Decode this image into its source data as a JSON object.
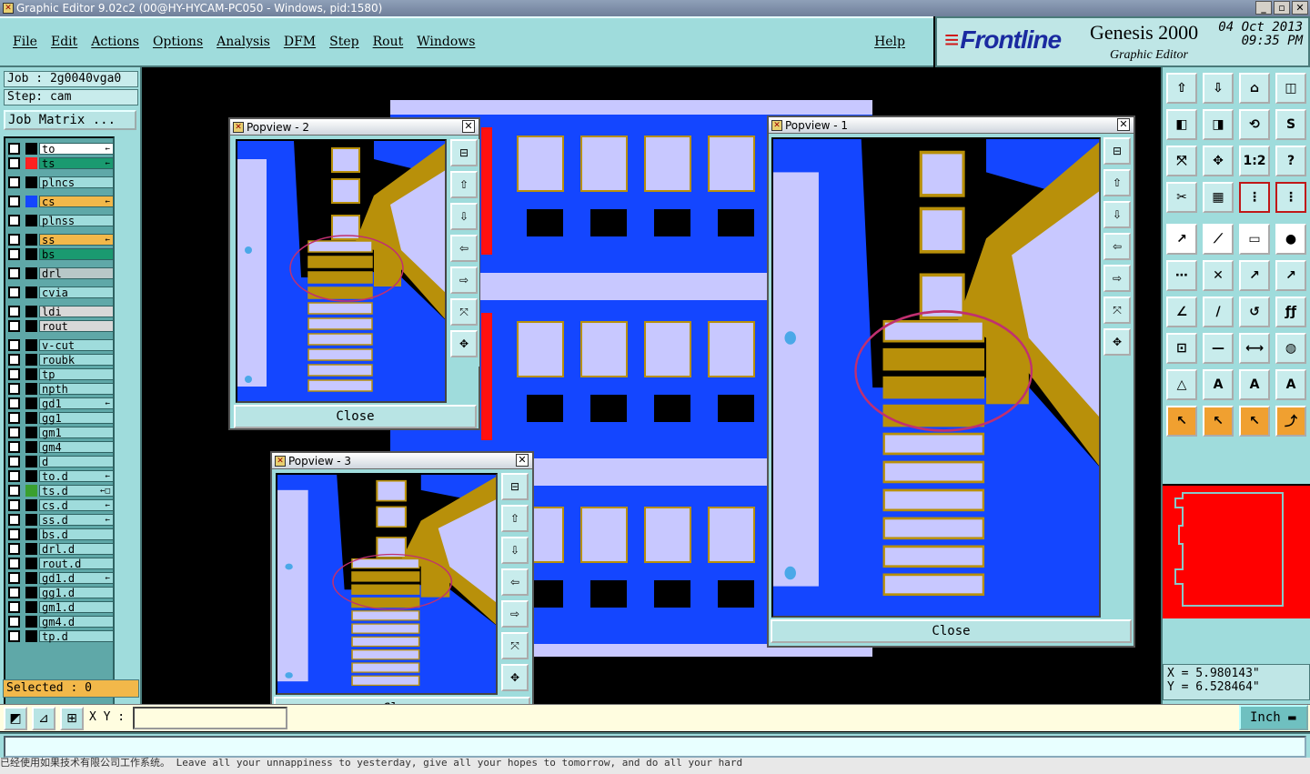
{
  "window": {
    "title": "Graphic Editor 9.02c2 (00@HY-HYCAM-PC050 - Windows, pid:1580)",
    "icon": "app-icon"
  },
  "menu": {
    "items": [
      "File",
      "Edit",
      "Actions",
      "Options",
      "Analysis",
      "DFM",
      "Step",
      "Rout",
      "Windows"
    ],
    "help": "Help"
  },
  "brand": {
    "logo": "Frontline",
    "product": "Genesis 2000",
    "subtitle": "Graphic Editor",
    "date": "04 Oct 2013",
    "time": "09:35 PM"
  },
  "job": {
    "job": "Job : 2g0040vga0",
    "step": "Step: cam",
    "matrix_button": "Job Matrix ..."
  },
  "layers": [
    {
      "name": "to",
      "color": "#ffffff",
      "swatch": "#000000",
      "arrow": "←"
    },
    {
      "name": "ts",
      "color": "#1a9a70",
      "swatch": "#ff2020",
      "arrow": "←"
    },
    {
      "name": "plncs",
      "color": "#9fdcdc",
      "swatch": "#000000",
      "arrow": ""
    },
    {
      "name": "cs",
      "color": "#f2b84a",
      "swatch": "#1446ff",
      "arrow": "←"
    },
    {
      "name": "plnss",
      "color": "#9fdcdc",
      "swatch": "#000000",
      "arrow": ""
    },
    {
      "name": "ss",
      "color": "#f2b84a",
      "swatch": "#000000",
      "arrow": "←"
    },
    {
      "name": "bs",
      "color": "#1a9a70",
      "swatch": "#000000",
      "arrow": ""
    },
    {
      "name": "drl",
      "color": "#b8c8c8",
      "swatch": "#000000",
      "arrow": ""
    },
    {
      "name": "cvia",
      "color": "#9fdcdc",
      "swatch": "#000000",
      "arrow": ""
    },
    {
      "name": "ldi",
      "color": "#d8d8d8",
      "swatch": "#000000",
      "arrow": ""
    },
    {
      "name": "rout",
      "color": "#d8d8d8",
      "swatch": "#000000",
      "arrow": ""
    },
    {
      "name": "v-cut",
      "color": "#9fdcdc",
      "swatch": "#000000",
      "arrow": ""
    },
    {
      "name": "roubk",
      "color": "#9fdcdc",
      "swatch": "#000000",
      "arrow": ""
    },
    {
      "name": "tp",
      "color": "#9fdcdc",
      "swatch": "#000000",
      "arrow": ""
    },
    {
      "name": "npth",
      "color": "#9fdcdc",
      "swatch": "#000000",
      "arrow": ""
    },
    {
      "name": "gd1",
      "color": "#9fdcdc",
      "swatch": "#000000",
      "arrow": "←"
    },
    {
      "name": "gg1",
      "color": "#9fdcdc",
      "swatch": "#000000",
      "arrow": ""
    },
    {
      "name": "gm1",
      "color": "#9fdcdc",
      "swatch": "#000000",
      "arrow": ""
    },
    {
      "name": "gm4",
      "color": "#9fdcdc",
      "swatch": "#000000",
      "arrow": ""
    },
    {
      "name": "d",
      "color": "#9fdcdc",
      "swatch": "#000000",
      "arrow": ""
    },
    {
      "name": "to.d",
      "color": "#9fdcdc",
      "swatch": "#000000",
      "arrow": "←"
    },
    {
      "name": "ts.d",
      "color": "#9fdcdc",
      "swatch": "#3aa030",
      "arrow": "←□"
    },
    {
      "name": "cs.d",
      "color": "#9fdcdc",
      "swatch": "#000000",
      "arrow": "←"
    },
    {
      "name": "ss.d",
      "color": "#9fdcdc",
      "swatch": "#000000",
      "arrow": "←"
    },
    {
      "name": "bs.d",
      "color": "#9fdcdc",
      "swatch": "#000000",
      "arrow": ""
    },
    {
      "name": "drl.d",
      "color": "#9fdcdc",
      "swatch": "#000000",
      "arrow": ""
    },
    {
      "name": "rout.d",
      "color": "#9fdcdc",
      "swatch": "#000000",
      "arrow": ""
    },
    {
      "name": "gd1.d",
      "color": "#9fdcdc",
      "swatch": "#000000",
      "arrow": "←"
    },
    {
      "name": "gg1.d",
      "color": "#9fdcdc",
      "swatch": "#000000",
      "arrow": ""
    },
    {
      "name": "gm1.d",
      "color": "#9fdcdc",
      "swatch": "#000000",
      "arrow": ""
    },
    {
      "name": "gm4.d",
      "color": "#9fdcdc",
      "swatch": "#000000",
      "arrow": ""
    },
    {
      "name": "tp.d",
      "color": "#9fdcdc",
      "swatch": "#000000",
      "arrow": ""
    }
  ],
  "selected": "Selected : 0",
  "coords": {
    "x": "X = 5.980143\"",
    "y": "Y = 6.528464\""
  },
  "popups": {
    "p1": {
      "title": "Popview - 1",
      "close": "Close"
    },
    "p2": {
      "title": "Popview - 2",
      "close": "Close"
    },
    "p3": {
      "title": "Popview - 3",
      "close": "Close"
    }
  },
  "bottom": {
    "xy_label": "X Y :",
    "units": "Inch"
  },
  "taskbar": {
    "text": "已经使用如果技术有限公司工作系统。      Leave all your unnappiness to yesterday, give all your hopes to tomorrow, and do all your hard"
  },
  "colors": {
    "accent": "#9fdcdc",
    "copper": "#b8900a",
    "pad": "#c8c8ff",
    "layer_blue": "#1446ff",
    "board": "#ff0000"
  }
}
